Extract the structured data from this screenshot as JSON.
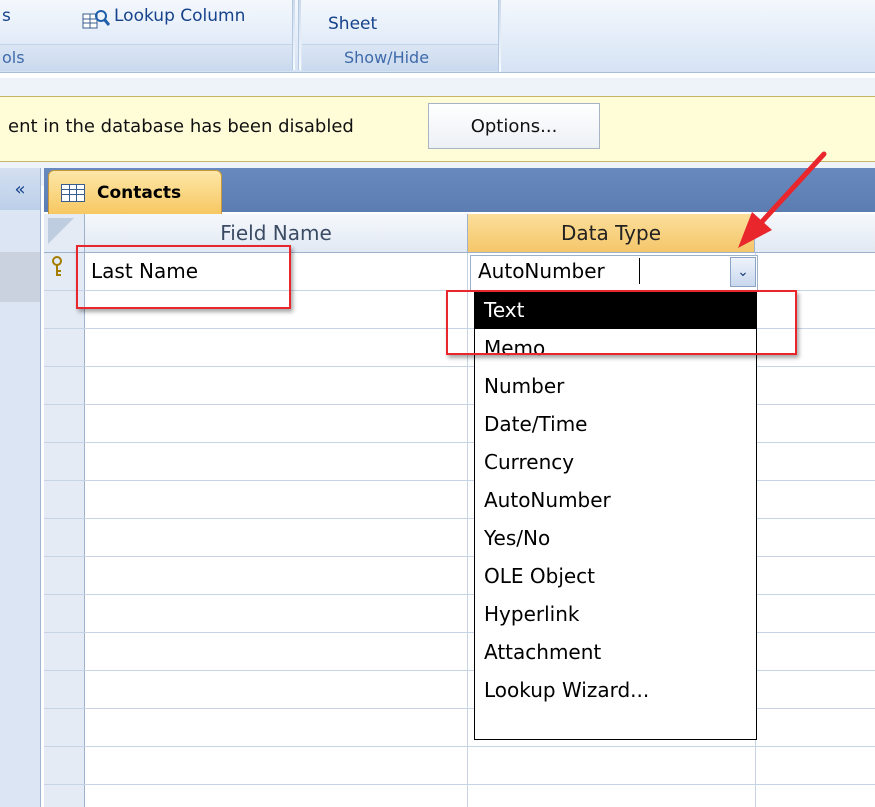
{
  "ribbon": {
    "left_partial_label": "s",
    "lookup_column_label": "Lookup Column",
    "sheet_label": "Sheet",
    "tools_group_label": "ols",
    "show_hide_group_label": "Show/Hide"
  },
  "message_bar": {
    "text": "ent in the database has been disabled",
    "options_button": "Options..."
  },
  "nav": {
    "shutter_label": "«"
  },
  "tab": {
    "label": "Contacts"
  },
  "grid": {
    "headers": {
      "field_name": "Field Name",
      "data_type": "Data Type"
    },
    "row1": {
      "field_name": "Last Name",
      "data_type": "AutoNumber"
    }
  },
  "dropdown": {
    "button_glyph": "⌄",
    "selected": "Text",
    "items": [
      "Text",
      "Memo",
      "Number",
      "Date/Time",
      "Currency",
      "AutoNumber",
      "Yes/No",
      "OLE Object",
      "Hyperlink",
      "Attachment",
      "Lookup Wizard..."
    ]
  },
  "colors": {
    "annotation_red": "#e8262b",
    "tab_orange": "#f7c760",
    "ribbon_blue": "#15428b"
  }
}
